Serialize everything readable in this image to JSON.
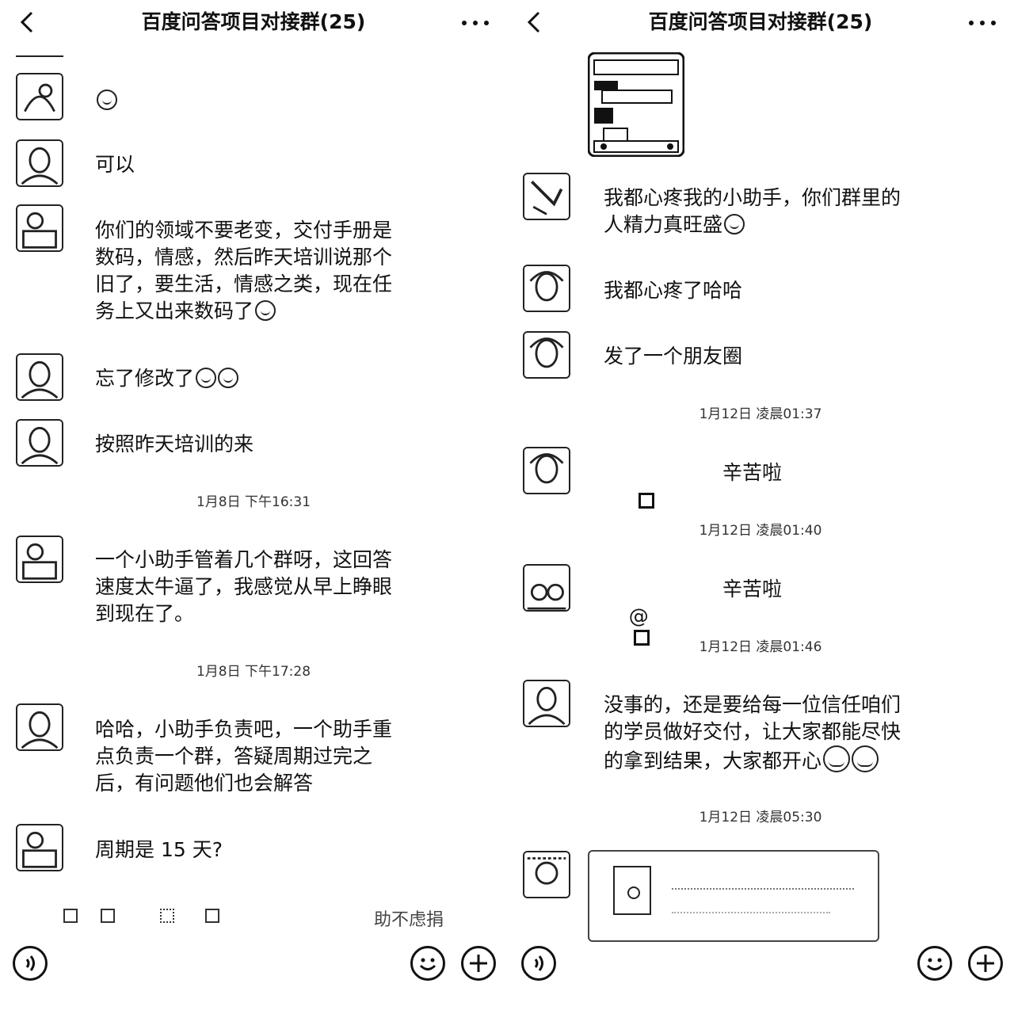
{
  "header": {
    "title": "百度问答项目对接群(25)"
  },
  "left": {
    "messages": [
      {
        "text": ""
      },
      {
        "text": "可以"
      },
      {
        "text": "你们的领域不要老变，交付手册是\n数码，情感，然后昨天培训说那个\n旧了，要生活，情感之类，现在任\n务上又出来数码了"
      },
      {
        "text": "忘了修改了"
      },
      {
        "text": "按照昨天培训的来"
      },
      {
        "text": "一个小助手管着几个群呀，这回答\n速度太牛逼了，我感觉从早上睁眼\n到现在了。"
      },
      {
        "text": "哈哈，小助手负责吧，一个助手重\n点负责一个群，答疑周期过完之\n后，有问题他们也会解答"
      },
      {
        "text": "周期是 15 天?"
      }
    ],
    "timestamps": [
      "1月8日 下午16:31",
      "1月8日 下午17:28"
    ],
    "faded_text": "助不虑捐"
  },
  "right": {
    "messages": [
      {
        "text": "我都心疼我的小助手，你们群里的\n人精力真旺盛"
      },
      {
        "text": "我都心疼了哈哈"
      },
      {
        "text": "发了一个朋友圈"
      },
      {
        "text": "辛苦啦"
      },
      {
        "text": "@"
      },
      {
        "text": "辛苦啦"
      },
      {
        "text": "没事的，还是要给每一位信任咱们\n的学员做好交付，让大家都能尽快\n的拿到结果，大家都开心"
      }
    ],
    "timestamps": [
      "1月12日 凌晨01:37",
      "1月12日 凌晨01:40",
      "1月12日 凌晨01:46",
      "1月12日 凌晨05:30"
    ]
  },
  "icons": {
    "back": "chevron-left-icon",
    "more": "more-dots-icon",
    "voice": "voice-icon",
    "emoji": "emoji-icon",
    "plus": "plus-icon"
  }
}
